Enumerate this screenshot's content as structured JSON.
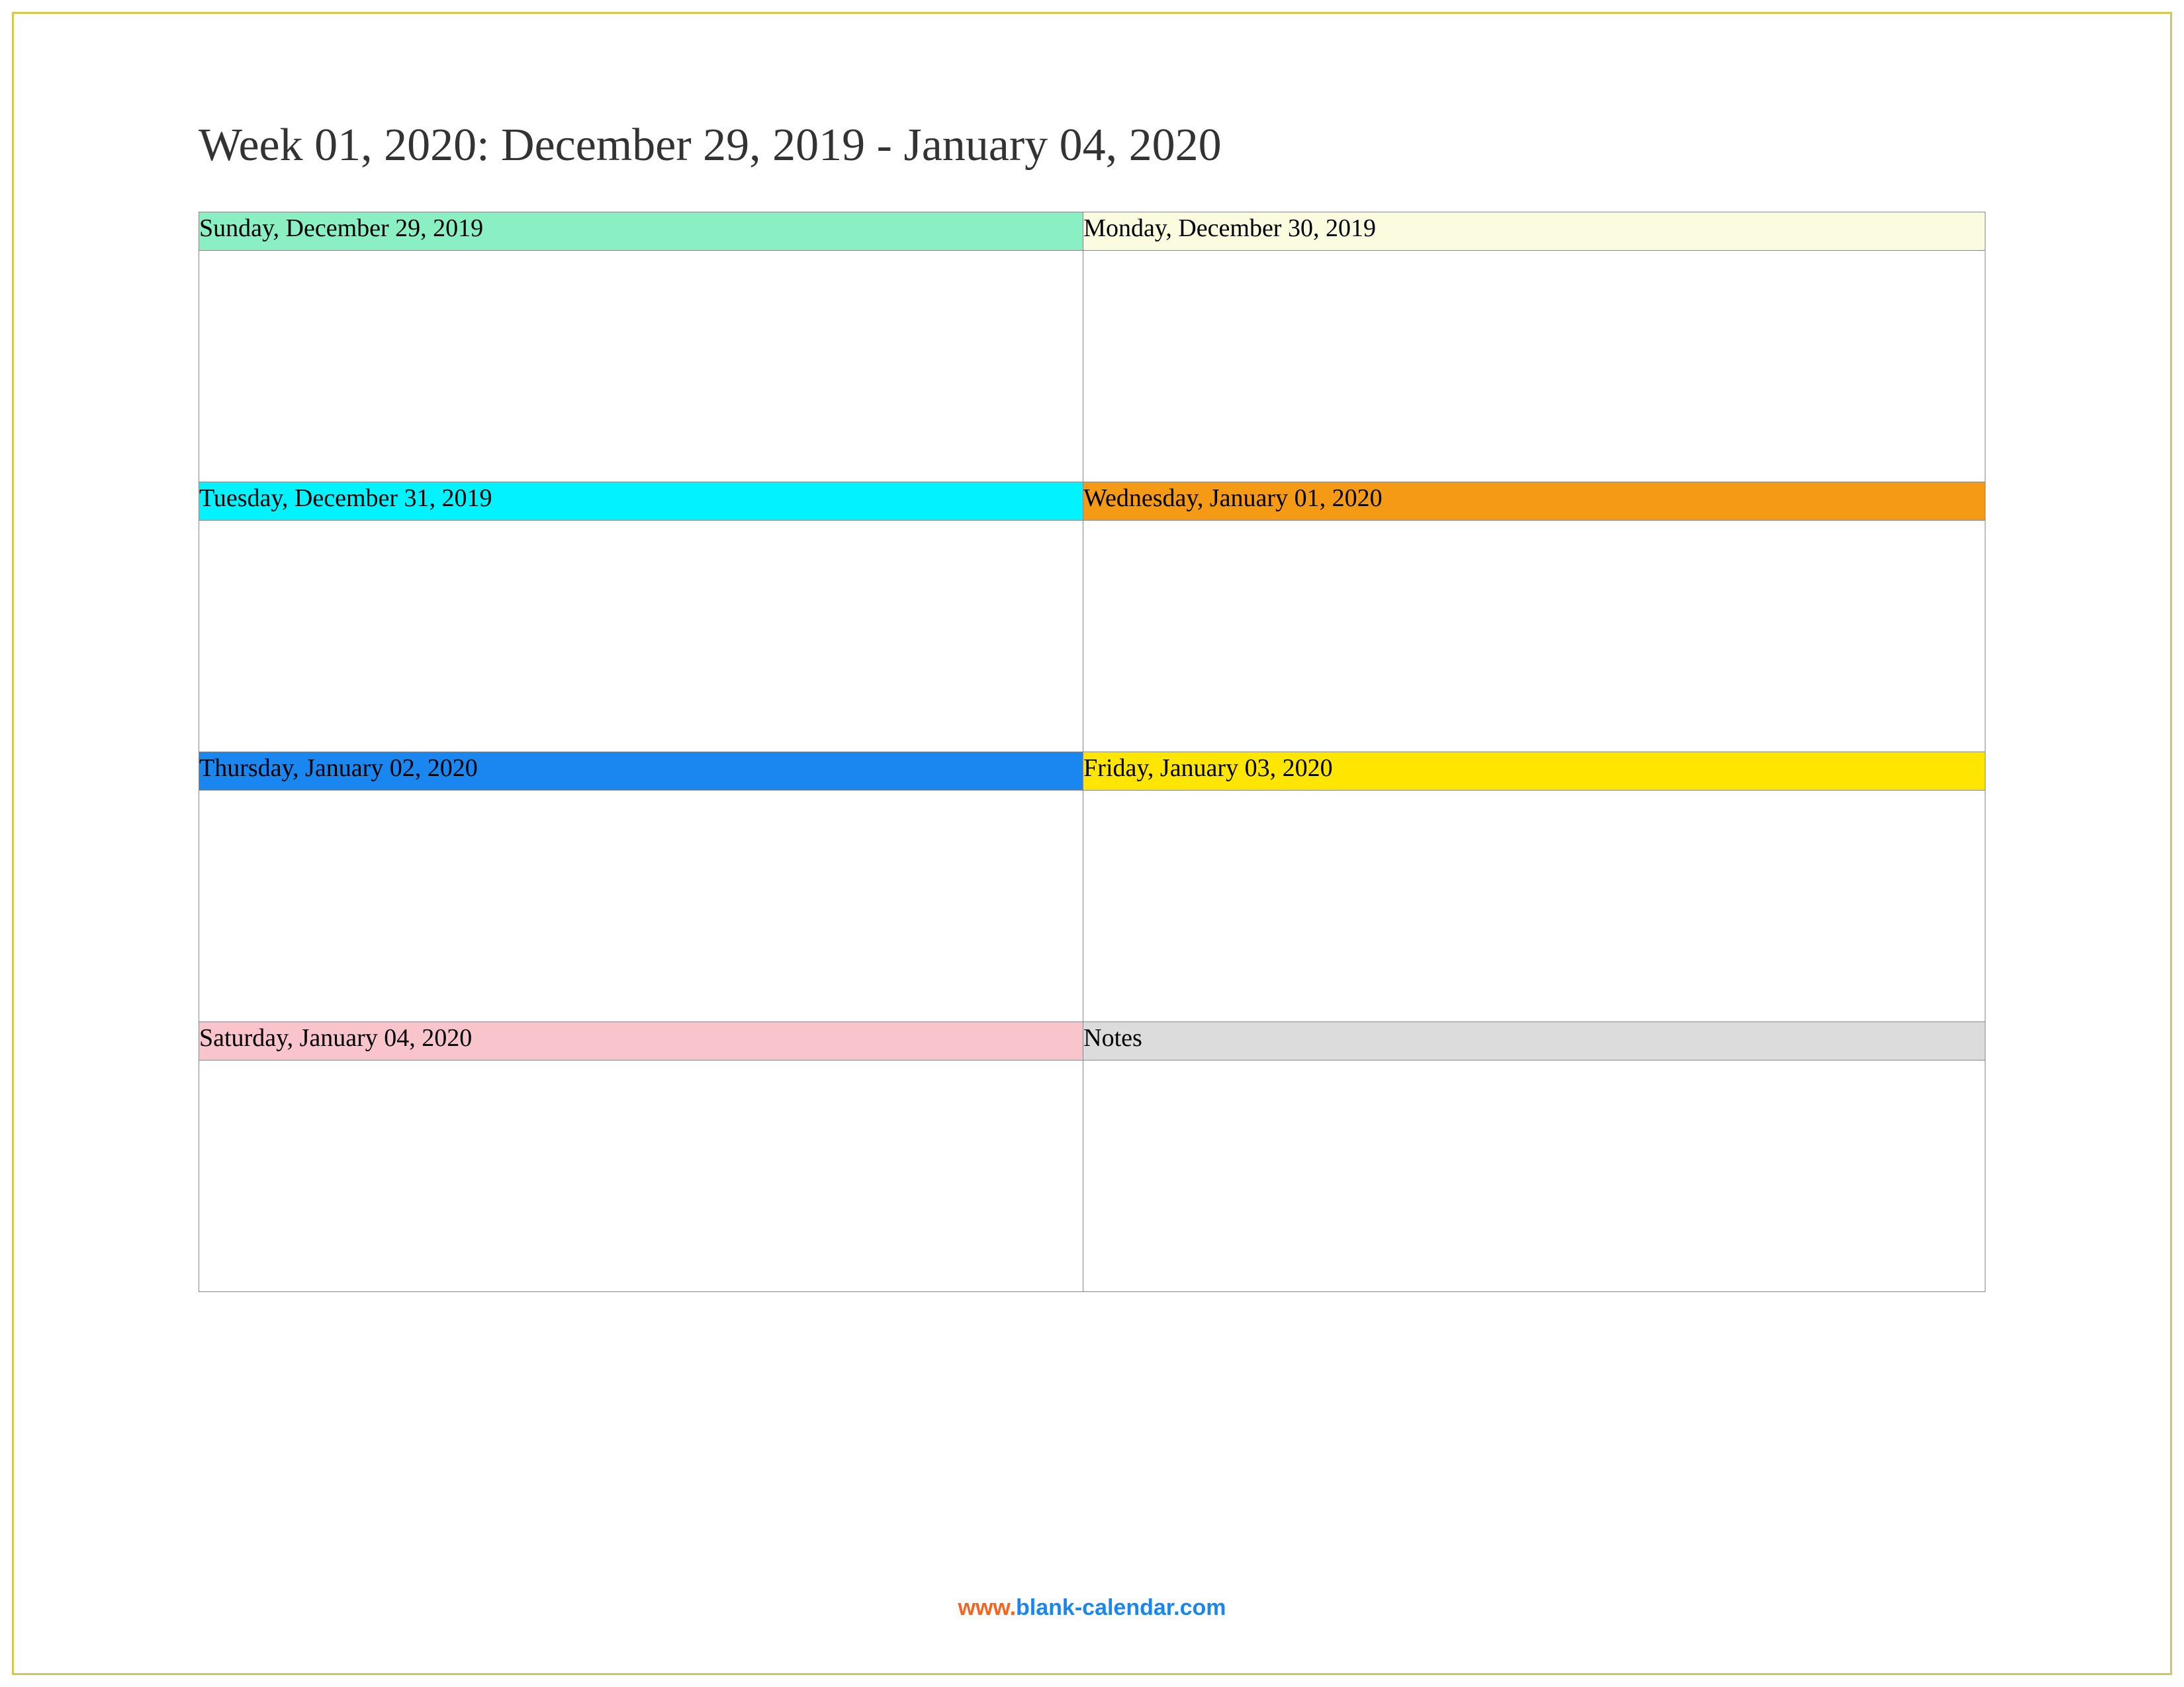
{
  "title": "Week 01, 2020: December 29, 2019 - January 04, 2020",
  "days": [
    {
      "label": "Sunday, December 29, 2019",
      "color": "c-mint"
    },
    {
      "label": "Monday, December 30, 2019",
      "color": "c-cream"
    },
    {
      "label": "Tuesday, December 31, 2019",
      "color": "c-cyan"
    },
    {
      "label": "Wednesday, January 01, 2020",
      "color": "c-orange"
    },
    {
      "label": "Thursday, January 02, 2020",
      "color": "c-blue"
    },
    {
      "label": "Friday, January 03, 2020",
      "color": "c-yellow"
    },
    {
      "label": "Saturday, January 04, 2020",
      "color": "c-pink"
    },
    {
      "label": "Notes",
      "color": "c-grey"
    }
  ],
  "footer": {
    "prefix": "www.",
    "domain": "blank-calendar.com"
  }
}
